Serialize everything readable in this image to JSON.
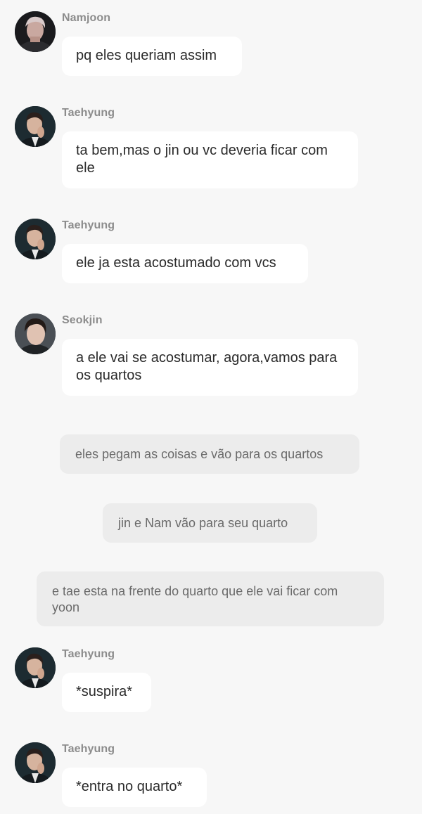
{
  "messages": [
    {
      "name": "Namjoon",
      "text": "pq eles queriam assim",
      "avatar": "namjoon"
    },
    {
      "name": "Taehyung",
      "text": "ta bem,mas o jin ou vc deveria ficar com ele",
      "avatar": "taehyung"
    },
    {
      "name": "Taehyung",
      "text": "ele ja esta acostumado com vcs",
      "avatar": "taehyung"
    },
    {
      "name": "Seokjin",
      "text": "a ele vai se acostumar, agora,vamos para os quartos",
      "avatar": "seokjin"
    }
  ],
  "narrations": [
    {
      "text": "eles pegam as coisas e vão para os quartos"
    },
    {
      "text": "jin e Nam vão para seu quarto"
    },
    {
      "text": "e tae esta na  frente do quarto que ele vai ficar com yoon"
    }
  ],
  "messages_after": [
    {
      "name": "Taehyung",
      "text": "*suspira*",
      "avatar": "taehyung"
    },
    {
      "name": "Taehyung",
      "text": "*entra no quarto*",
      "avatar": "taehyung"
    }
  ],
  "colors": {
    "background": "#f7f7f7",
    "bubble": "#ffffff",
    "narration_bubble": "#ececec",
    "name_text": "#8c8c8c",
    "message_text": "#2a2a2a"
  }
}
